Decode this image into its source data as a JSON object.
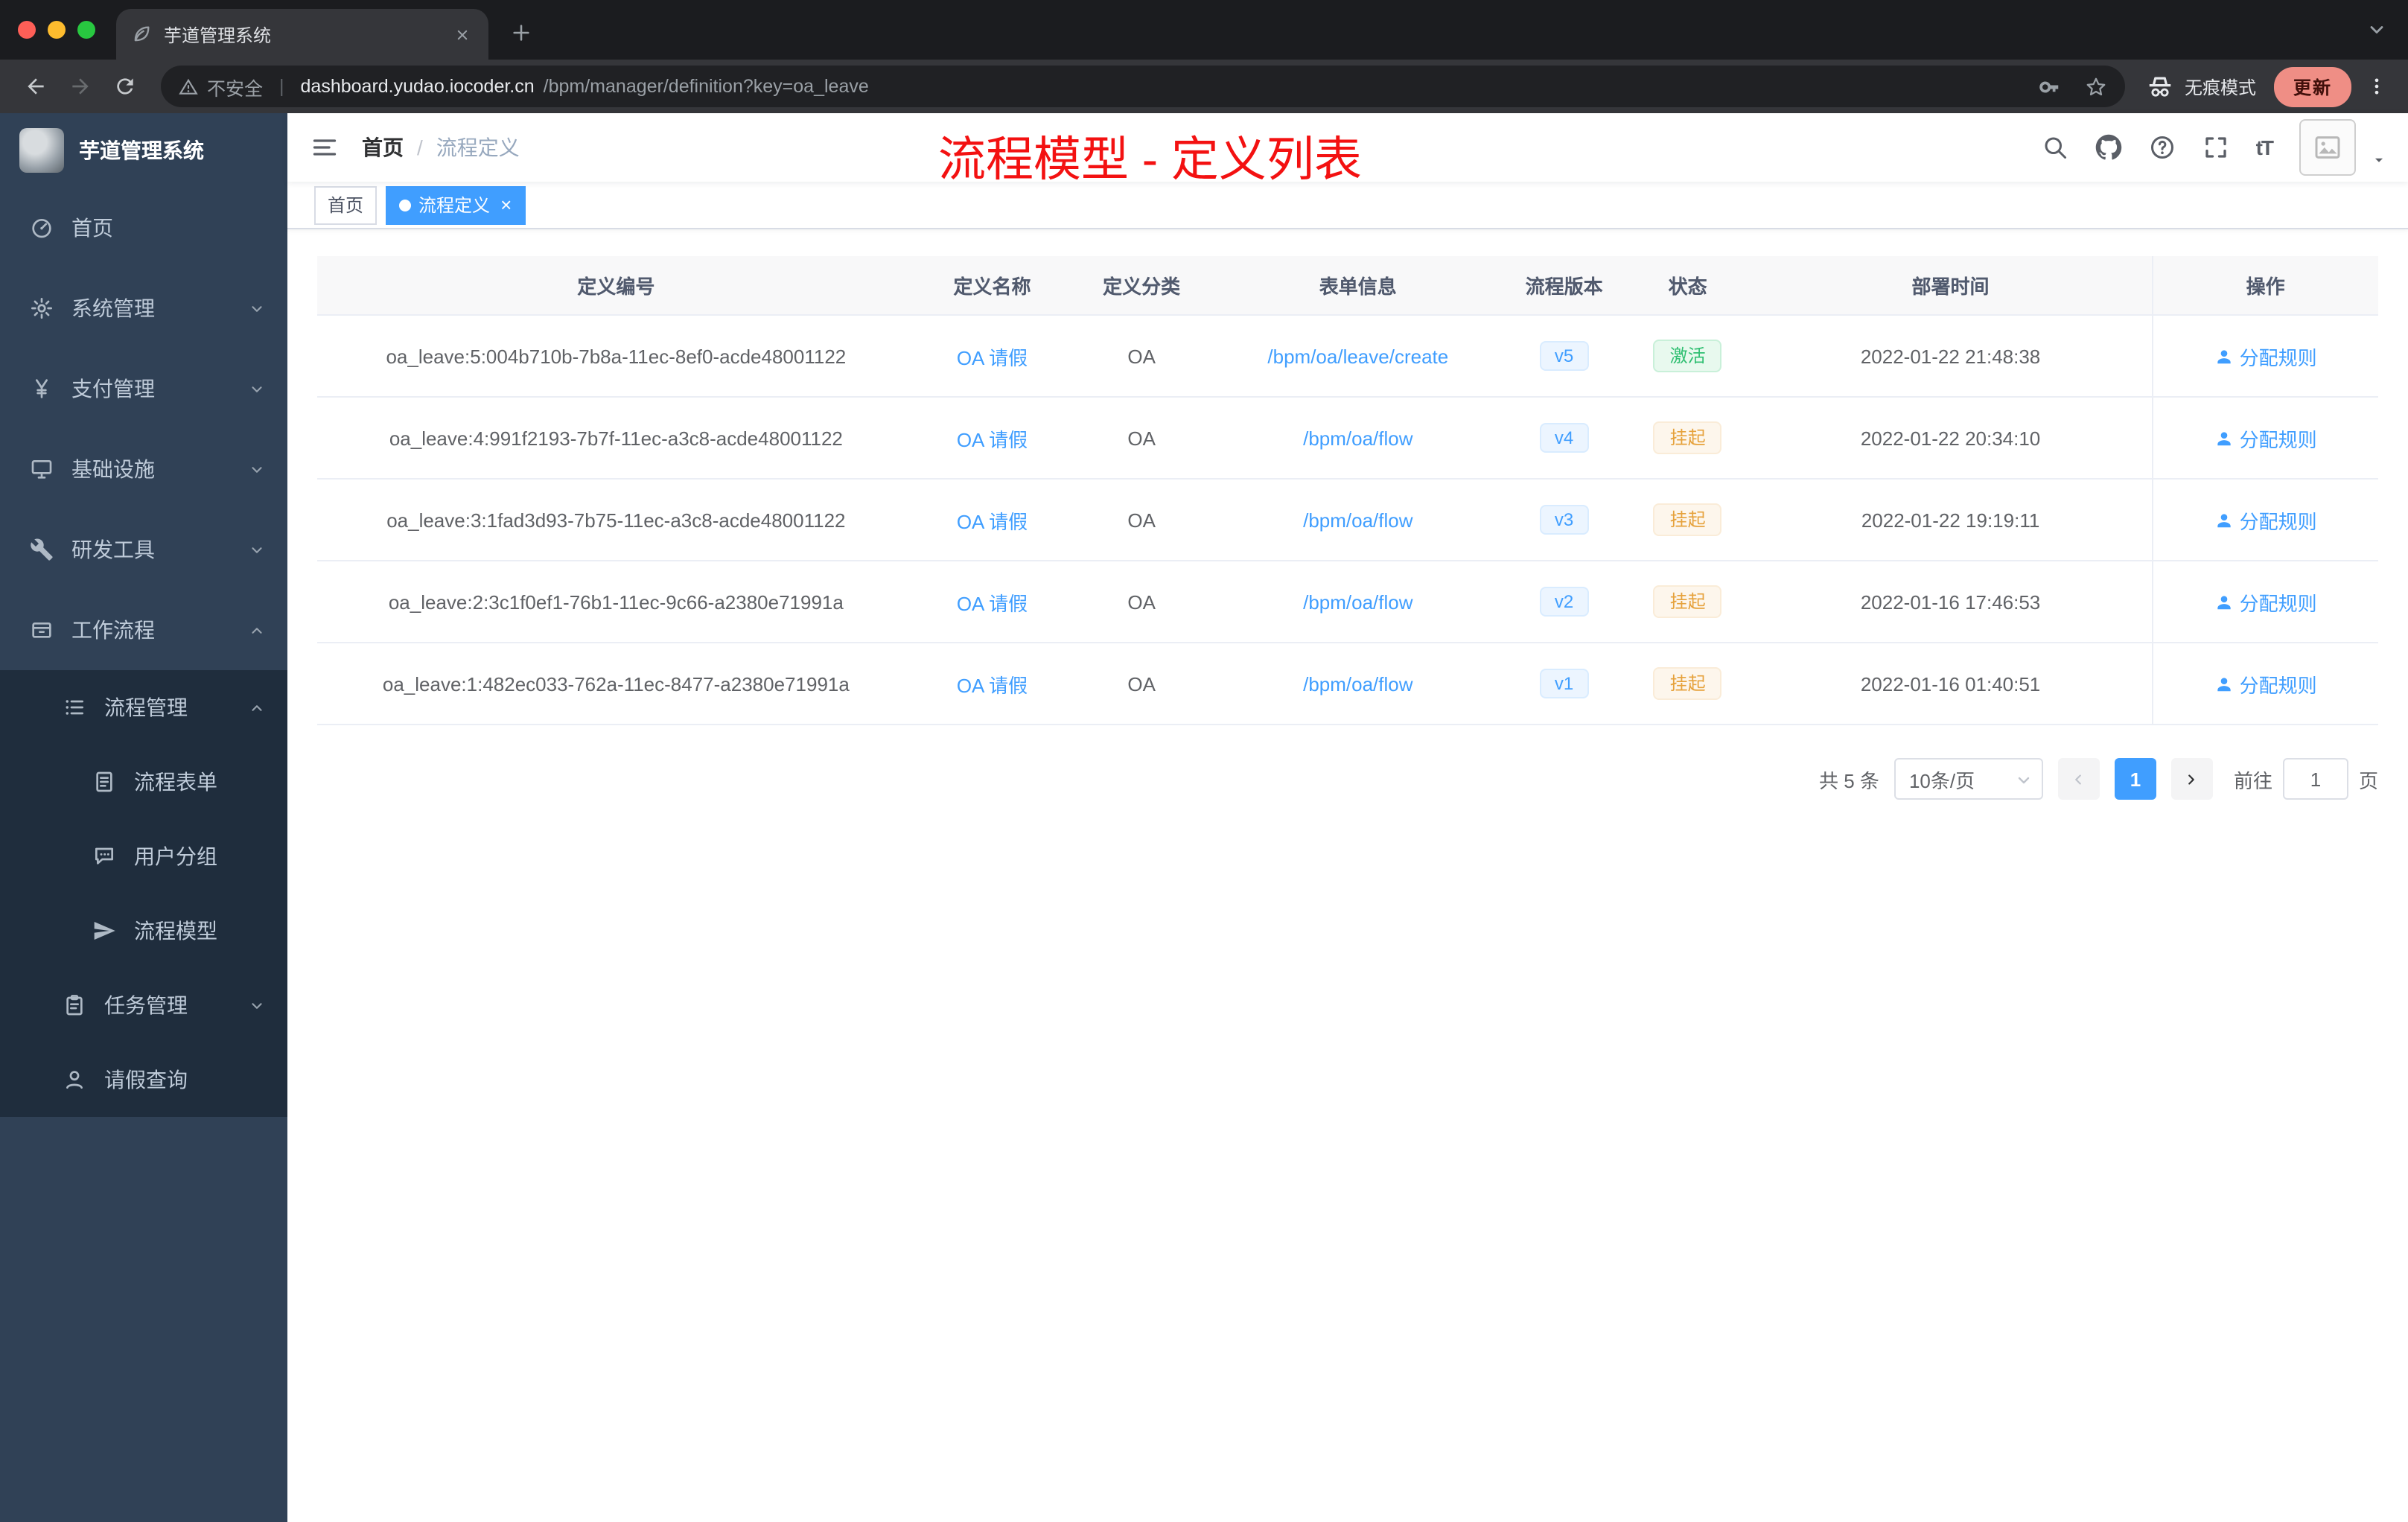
{
  "colors": {
    "accent": "#409eff",
    "success": "#2fbf71",
    "warning": "#e6a23c",
    "annotation_red": "#f31111",
    "sidebar_bg": "#304156",
    "submenu_bg": "#1f2d3d",
    "tag_active_bg": "#409eff"
  },
  "browser": {
    "tab_title": "芋道管理系统",
    "security_label": "不安全",
    "url_host": "dashboard.yudao.iocoder.cn",
    "url_path": "/bpm/manager/definition?key=oa_leave",
    "incognito_label": "无痕模式",
    "update_label": "更新",
    "icons": [
      "leaf-favicon-icon",
      "close-icon",
      "plus-icon",
      "chevron-down-icon",
      "back-icon",
      "forward-icon",
      "reload-icon",
      "warning-icon",
      "key-icon",
      "star-icon",
      "incognito-icon",
      "kebab-menu-icon"
    ]
  },
  "sidebar": {
    "logo_title": "芋道管理系统",
    "items": [
      {
        "label": "首页",
        "icon": "dashboard-icon"
      },
      {
        "label": "系统管理",
        "icon": "gear-icon"
      },
      {
        "label": "支付管理",
        "icon": "yen-icon"
      },
      {
        "label": "基础设施",
        "icon": "monitor-icon"
      },
      {
        "label": "研发工具",
        "icon": "wrench-icon"
      },
      {
        "label": "工作流程",
        "icon": "archive-icon"
      },
      {
        "label": "流程管理",
        "icon": "list-icon"
      },
      {
        "label": "流程表单",
        "icon": "document-icon"
      },
      {
        "label": "用户分组",
        "icon": "chat-icon"
      },
      {
        "label": "流程模型",
        "icon": "send-icon"
      },
      {
        "label": "任务管理",
        "icon": "clipboard-icon"
      },
      {
        "label": "请假查询",
        "icon": "user-icon"
      }
    ]
  },
  "navbar": {
    "breadcrumb": [
      "首页",
      "流程定义"
    ],
    "overlay_title": "流程模型 - 定义列表",
    "icons": [
      "hamburger-icon",
      "search-icon",
      "github-icon",
      "help-icon",
      "fullscreen-icon",
      "font-size-icon",
      "avatar",
      "chevron-down-icon"
    ],
    "font_size_glyph": "tT"
  },
  "tags": [
    {
      "label": "首页"
    },
    {
      "label": "流程定义",
      "close": "×"
    }
  ],
  "table": {
    "columns": [
      "定义编号",
      "定义名称",
      "定义分类",
      "表单信息",
      "流程版本",
      "状态",
      "部署时间",
      "操作"
    ],
    "rows": [
      {
        "id": "oa_leave:5:004b710b-7b8a-11ec-8ef0-acde48001122",
        "name": "OA 请假",
        "category": "OA",
        "form": "/bpm/oa/leave/create",
        "version": "v5",
        "status": "激活",
        "status_type": "success",
        "deploy_time": "2022-01-22 21:48:38",
        "action": "分配规则"
      },
      {
        "id": "oa_leave:4:991f2193-7b7f-11ec-a3c8-acde48001122",
        "name": "OA 请假",
        "category": "OA",
        "form": "/bpm/oa/flow",
        "version": "v4",
        "status": "挂起",
        "status_type": "warning",
        "deploy_time": "2022-01-22 20:34:10",
        "action": "分配规则"
      },
      {
        "id": "oa_leave:3:1fad3d93-7b75-11ec-a3c8-acde48001122",
        "name": "OA 请假",
        "category": "OA",
        "form": "/bpm/oa/flow",
        "version": "v3",
        "status": "挂起",
        "status_type": "warning",
        "deploy_time": "2022-01-22 19:19:11",
        "action": "分配规则"
      },
      {
        "id": "oa_leave:2:3c1f0ef1-76b1-11ec-9c66-a2380e71991a",
        "name": "OA 请假",
        "category": "OA",
        "form": "/bpm/oa/flow",
        "version": "v2",
        "status": "挂起",
        "status_type": "warning",
        "deploy_time": "2022-01-16 17:46:53",
        "action": "分配规则"
      },
      {
        "id": "oa_leave:1:482ec033-762a-11ec-8477-a2380e71991a",
        "name": "OA 请假",
        "category": "OA",
        "form": "/bpm/oa/flow",
        "version": "v1",
        "status": "挂起",
        "status_type": "warning",
        "deploy_time": "2022-01-16 01:40:51",
        "action": "分配规则"
      }
    ]
  },
  "pagination": {
    "total": "共 5 条",
    "page_size": "10条/页",
    "page": "1",
    "goto_label": "前往",
    "goto_value": "1",
    "unit_label": "页"
  }
}
